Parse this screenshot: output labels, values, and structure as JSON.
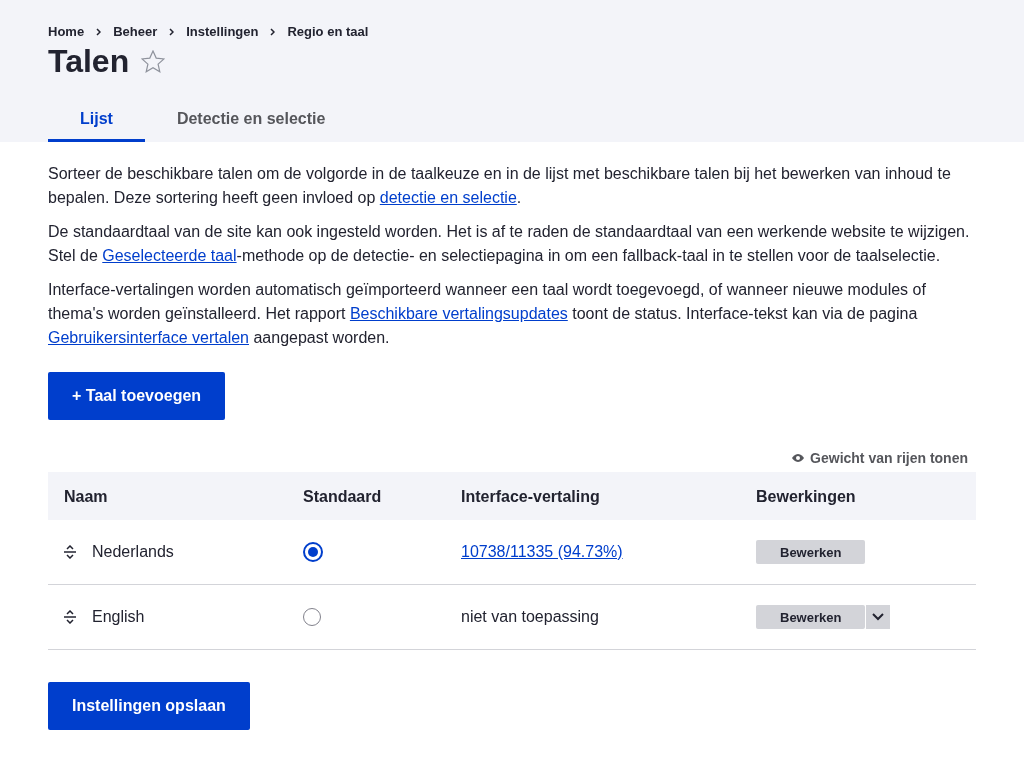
{
  "breadcrumb": [
    "Home",
    "Beheer",
    "Instellingen",
    "Regio en taal"
  ],
  "title": "Talen",
  "favorite": false,
  "tabs": [
    {
      "label": "Lijst",
      "selected": true
    },
    {
      "label": "Detectie en selectie",
      "selected": false
    }
  ],
  "paragraphs": [
    [
      {
        "kind": "text",
        "text": "Sorteer de beschikbare talen om de volgorde in de taalkeuze en in de lijst met beschikbare talen bij het bewerken van inhoud te bepalen. Deze sortering heeft geen invloed op "
      },
      {
        "kind": "link",
        "text": "detectie en selectie"
      },
      {
        "kind": "text",
        "text": "."
      }
    ],
    [
      {
        "kind": "text",
        "text": "De standaardtaal van de site kan ook ingesteld worden. Het is af te raden de standaardtaal van een werkende website te wijzigen. Stel de "
      },
      {
        "kind": "link",
        "text": "Geselecteerde taal"
      },
      {
        "kind": "text",
        "text": "-methode op de detectie- en selectiepagina in om een fallback-taal in te stellen voor de taalselectie."
      }
    ],
    [
      {
        "kind": "text",
        "text": "Interface-vertalingen worden automatisch geïmporteerd wanneer een taal wordt toegevoegd, of wanneer nieuwe modules of thema's worden geïnstalleerd. Het rapport "
      },
      {
        "kind": "link",
        "text": "Beschikbare vertalingsupdates"
      },
      {
        "kind": "text",
        "text": " toont de status. Interface-tekst kan via de pagina "
      },
      {
        "kind": "link",
        "text": "Gebruikersinterface vertalen"
      },
      {
        "kind": "text",
        "text": " aangepast worden."
      }
    ]
  ],
  "add_button": "+ Taal toevoegen",
  "weights_toggle": "Gewicht van rijen tonen",
  "table": {
    "columns": [
      "Naam",
      "Standaard",
      "Interface-vertaling",
      "Bewerkingen"
    ],
    "rows": [
      {
        "name": "Nederlands",
        "selected": true,
        "translation": {
          "kind": "link",
          "text": "10738/11335 (94.73%)"
        },
        "operation": "Bewerken",
        "has_dropdown": false
      },
      {
        "name": "English",
        "selected": false,
        "translation": {
          "kind": "text",
          "text": "niet van toepassing"
        },
        "operation": "Bewerken",
        "has_dropdown": true
      }
    ]
  },
  "save_button": "Instellingen opslaan"
}
